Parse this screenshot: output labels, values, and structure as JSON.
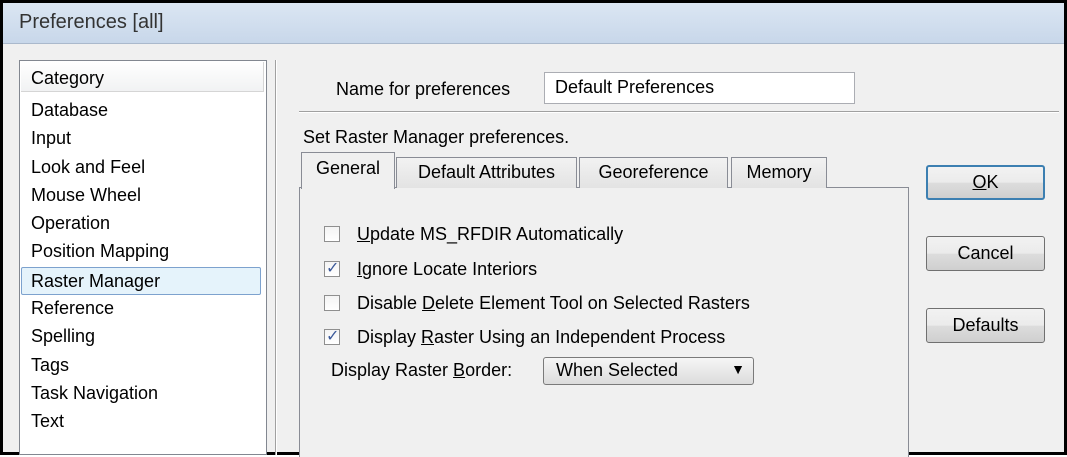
{
  "window": {
    "title": "Preferences [all]"
  },
  "category": {
    "header": "Category",
    "items": [
      "Database",
      "Input",
      "Look and Feel",
      "Mouse Wheel",
      "Operation",
      "Position Mapping",
      "Raster Manager",
      "Reference",
      "Spelling",
      "Tags",
      "Task Navigation",
      "Text"
    ],
    "selected": "Raster Manager"
  },
  "name": {
    "label": "Name for preferences",
    "value": "Default Preferences"
  },
  "section_label": "Set Raster Manager preferences.",
  "tabs": [
    {
      "label": "General",
      "active": true
    },
    {
      "label": "Default Attributes",
      "active": false
    },
    {
      "label": "Georeference",
      "active": false
    },
    {
      "label": "Memory",
      "active": false
    }
  ],
  "options": [
    {
      "pre": "",
      "u": "U",
      "post": "pdate MS_RFDIR Automatically",
      "checked": false
    },
    {
      "pre": "",
      "u": "I",
      "post": "gnore Locate Interiors",
      "checked": true
    },
    {
      "pre": "Disable ",
      "u": "D",
      "post": "elete Element Tool on Selected Rasters",
      "checked": false
    },
    {
      "pre": "Display ",
      "u": "R",
      "post": "aster Using an Independent Process",
      "checked": true
    }
  ],
  "border": {
    "label_pre": "Display Raster ",
    "label_u": "B",
    "label_post": "order:",
    "value": "When Selected"
  },
  "buttons": {
    "ok_u": "O",
    "ok_post": "K",
    "cancel": "Cancel",
    "defaults": "Defaults"
  }
}
